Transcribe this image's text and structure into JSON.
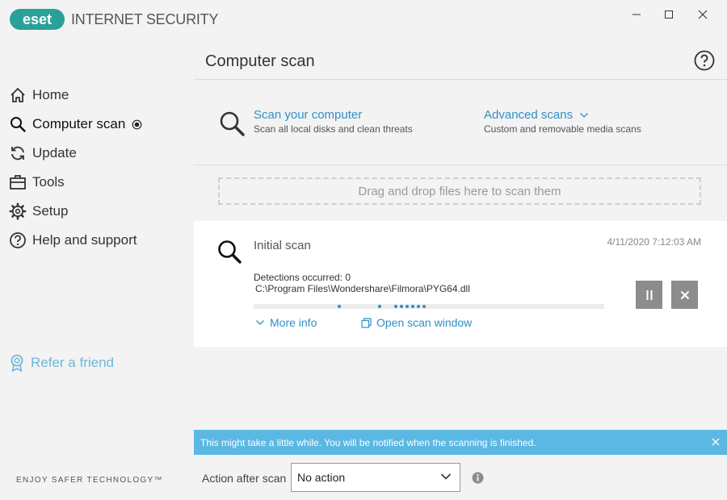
{
  "window": {
    "logo_text": "eset",
    "product_name": "INTERNET SECURITY",
    "minimize_icon": "minimize-icon",
    "maximize_icon": "maximize-icon",
    "close_icon": "close-icon"
  },
  "sidebar": {
    "items": [
      {
        "label": "Home",
        "icon": "home-icon"
      },
      {
        "label": "Computer scan",
        "icon": "search-icon",
        "active": true
      },
      {
        "label": "Update",
        "icon": "refresh-icon"
      },
      {
        "label": "Tools",
        "icon": "toolbox-icon"
      },
      {
        "label": "Setup",
        "icon": "gear-icon"
      },
      {
        "label": "Help and support",
        "icon": "help-icon"
      }
    ],
    "refer": "Refer a friend",
    "tagline": "ENJOY SAFER TECHNOLOGY™"
  },
  "main": {
    "title": "Computer scan",
    "scan_computer": {
      "title": "Scan your computer",
      "subtitle": "Scan all local disks and clean threats"
    },
    "advanced_scans": {
      "title": "Advanced scans",
      "subtitle": "Custom and removable media scans"
    },
    "dropzone": "Drag and drop files here to scan them",
    "scan_card": {
      "name": "Initial scan",
      "timestamp": "4/11/2020 7:12:03 AM",
      "detections": "Detections occurred: 0",
      "current_file": "C:\\Program Files\\Wondershare\\Filmora\\PYG64.dll",
      "more_info": "More info",
      "open_window": "Open scan window"
    },
    "info_bar": "This might take a little while. You will be notified when the scanning is finished.",
    "action_label": "Action after scan",
    "action_value": "No action"
  },
  "colors": {
    "accent": "#2f8fc7",
    "info_bar": "#5bb8e2",
    "refer": "#6cb8d9",
    "logo": "#2aa09a",
    "control_button": "#8c8c8c"
  }
}
